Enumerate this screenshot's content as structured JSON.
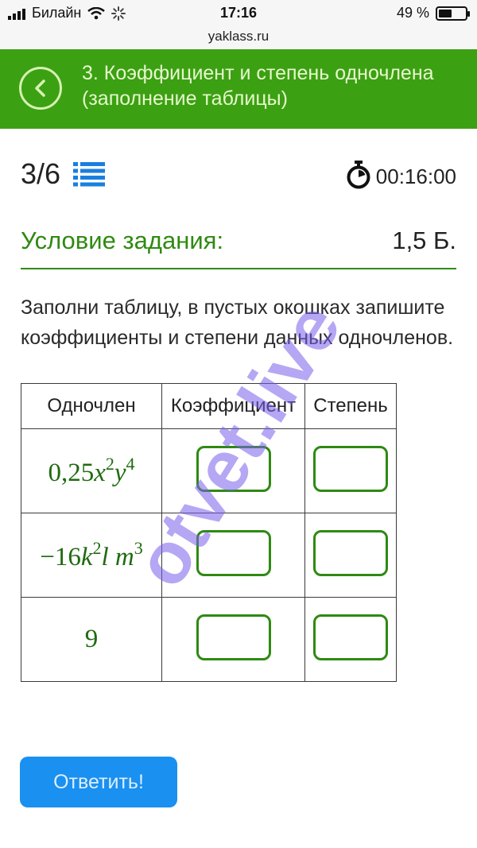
{
  "status_bar": {
    "carrier": "Билайн",
    "time": "17:16",
    "battery": "49 %",
    "battery_level": 0.49,
    "url": "yaklass.ru"
  },
  "header": {
    "title": "3. Коэффициент и степень одночлена (заполнение таблицы)",
    "back_icon": "chevron-left-icon"
  },
  "progress": {
    "text": "3/6",
    "list_icon": "list-icon",
    "timer_icon": "stopwatch-icon",
    "timer": "00:16:00"
  },
  "condition": {
    "title": "Условие задания:",
    "points": "1,5 Б.",
    "text": "Заполни таблицу, в пустых окошках запишите коэффициенты и степени данных одночленов."
  },
  "table": {
    "headers": [
      "Одночлен",
      "Коэффициент",
      "Степень"
    ],
    "rows": [
      {
        "monomial": "0,25x²y⁴",
        "coefficient": "",
        "degree": ""
      },
      {
        "monomial": "−16k²lm³",
        "coefficient": "",
        "degree": ""
      },
      {
        "monomial": "9",
        "coefficient": "",
        "degree": ""
      }
    ]
  },
  "submit_label": "Ответить!",
  "watermark": "otvet.live",
  "colors": {
    "header_green": "#3ca013",
    "accent_green": "#2f8a12",
    "button_blue": "#1a90f0",
    "watermark": "#785feb"
  }
}
